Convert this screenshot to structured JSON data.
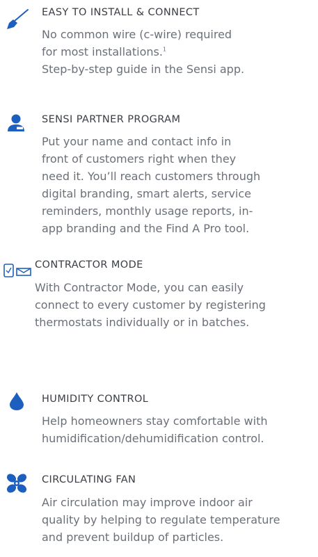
{
  "colors": {
    "accent": "#1d5fbf",
    "title": "#3a3e44",
    "body": "#6b7078"
  },
  "features": [
    {
      "icon": "screwdriver-icon",
      "title": "EASY TO INSTALL & CONNECT",
      "lines": [
        "No common wire (c-wire) required",
        "for most installations.",
        "Step-by-step guide in the Sensi app."
      ],
      "footnote": "1"
    },
    {
      "icon": "person-icon",
      "title": "SENSI PARTNER PROGRAM",
      "lines": [
        "Put your name and contact info in",
        "front of customers right when they",
        "need it. You’ll reach customers through",
        "digital branding, smart alerts, service",
        "reminders, monthly usage reports, in-",
        "app branding and the Find A Pro tool."
      ]
    },
    {
      "icon": "contractor-devices-icon",
      "title": "CONTRACTOR MODE",
      "lines": [
        "With Contractor Mode, you can easily",
        "connect to every customer by registering",
        "thermostats individually or in batches."
      ]
    },
    {
      "icon": "water-drop-icon",
      "title": "HUMIDITY CONTROL",
      "lines": [
        "Help homeowners stay comfortable with",
        "humidification/dehumidification control."
      ]
    },
    {
      "icon": "fan-icon",
      "title": "CIRCULATING FAN",
      "lines": [
        "Air circulation may improve indoor air",
        "quality by helping to regulate temperature",
        "and prevent buildup of particles."
      ]
    }
  ]
}
